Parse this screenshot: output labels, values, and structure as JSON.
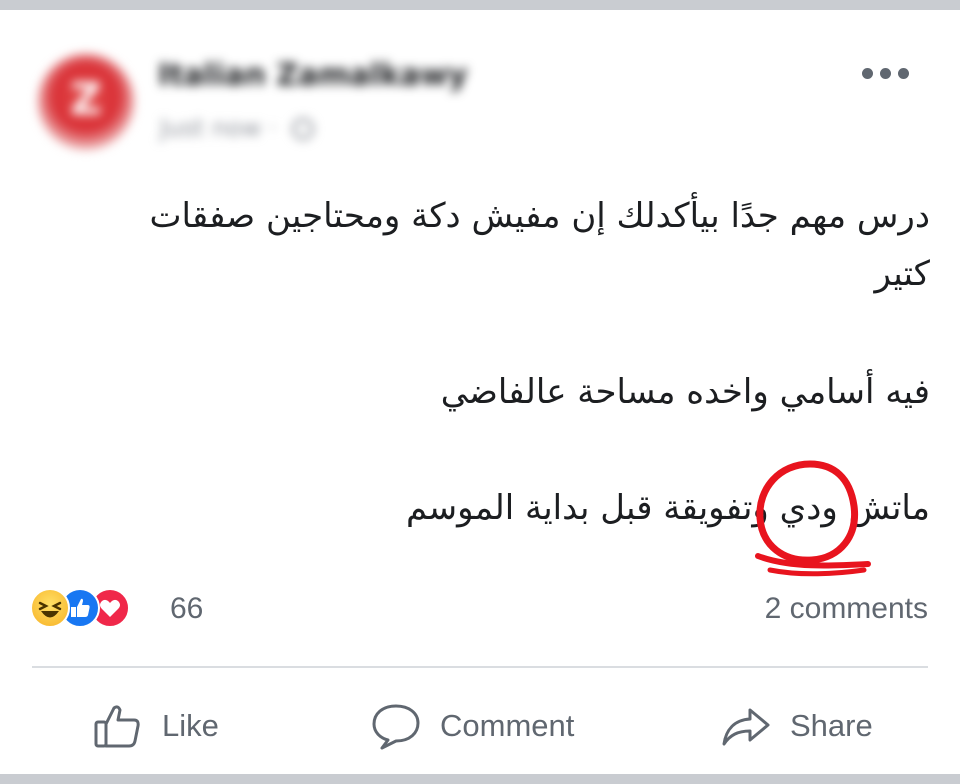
{
  "post": {
    "author": "Italian Zamalkawy",
    "timestamp": "Just now",
    "privacy_icon": "globe-icon",
    "avatar_letter": "Z",
    "lines": [
      "درس مهم جدًا بيأكدلك إن مفيش دكة ومحتاجين صفقات",
      "كتير",
      "فيه أسامي واخده مساحة عالفاضي",
      "ماتش ودي وتفويقة قبل بداية الموسم"
    ],
    "highlighted_word": "ودي",
    "highlight_color": "#e8141e"
  },
  "reactions": {
    "icons": [
      "haha-icon",
      "like-icon",
      "love-icon"
    ],
    "count": "66"
  },
  "comments_label": "2 comments",
  "actions": {
    "like": "Like",
    "comment": "Comment",
    "share": "Share"
  },
  "colors": {
    "background": "#c9ccd1",
    "card": "#ffffff",
    "text": "#1c1e21",
    "secondary_text": "#606770",
    "like_blue": "#1877f2",
    "love_red": "#f0284a"
  }
}
